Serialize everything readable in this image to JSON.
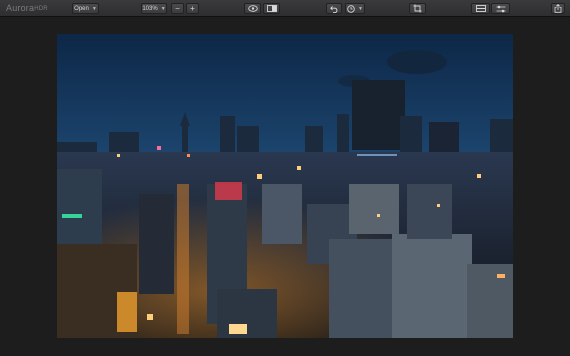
{
  "app": {
    "logo_main": "Aurora",
    "logo_small": "HDR"
  },
  "toolbar": {
    "open_label": "Open",
    "zoom_value": "103%",
    "zoom_out_symbol": "−",
    "zoom_in_symbol": "+"
  },
  "icons": {
    "eye": "eye-icon",
    "compare": "compare-icon",
    "undo": "undo-icon",
    "history": "history-icon",
    "crop": "crop-icon",
    "presets": "presets-icon",
    "adjustments": "sliders-icon",
    "share": "share-icon"
  },
  "colors": {
    "toolbar": "#333335",
    "canvas": "#1d1d1e",
    "sky_top": "#0f2a4a",
    "sky_horizon": "#3f6d96"
  }
}
